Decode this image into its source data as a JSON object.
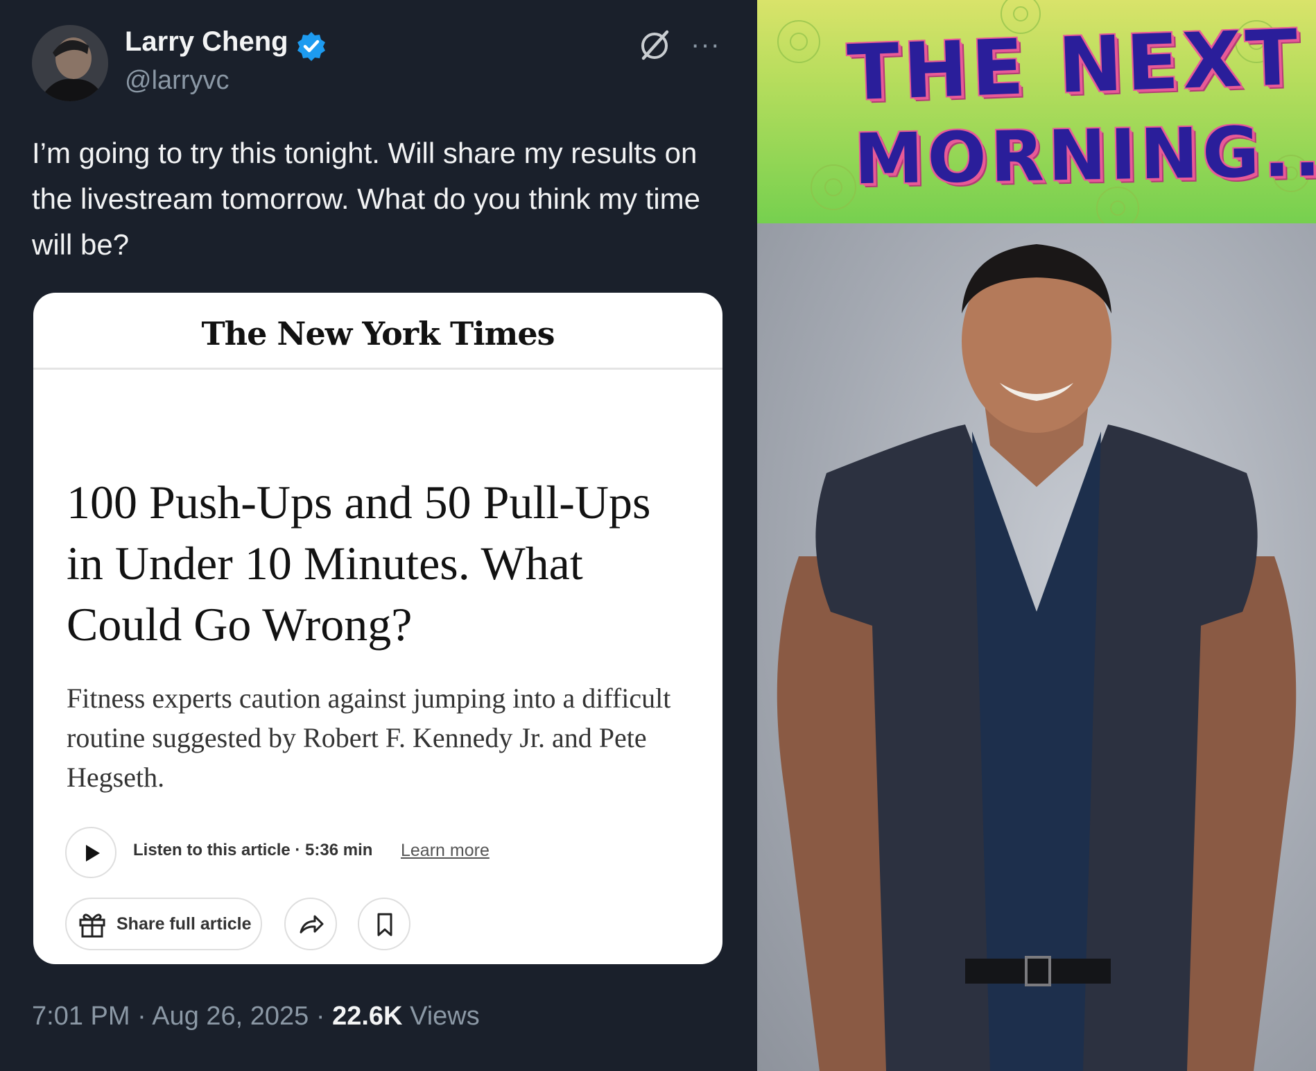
{
  "tweet": {
    "author_name": "Larry Cheng",
    "handle": "@larryvc",
    "text": "I’m going to try this tonight. Will share my results on the livestream tomorrow. What do you think my time will be?",
    "time": "7:01 PM",
    "date": "Aug 26, 2025",
    "views_count": "22.6K",
    "views_label": "Views",
    "separator": "·",
    "more_label": "···"
  },
  "article": {
    "publication": "The New York Times",
    "headline": "100 Push-Ups and 50 Pull-Ups in Under 10 Minutes. What Could Go Wrong?",
    "summary": "Fitness experts caution against jumping into a difficult routine suggested by Robert F. Kennedy Jr. and Pete Hegseth.",
    "listen_label": "Listen to this article · 5:36 min",
    "learn_more": "Learn more",
    "share_full": "Share full article"
  },
  "meme": {
    "title_line1": "THE NEXT",
    "title_line2": "MORNING..."
  },
  "colors": {
    "tweet_bg": "#1a202b",
    "verified_blue": "#1d9bf0",
    "card_title_text": "#2a1e9a",
    "card_title_outline": "#e85a97",
    "card_bg_green": "#76d04f"
  }
}
